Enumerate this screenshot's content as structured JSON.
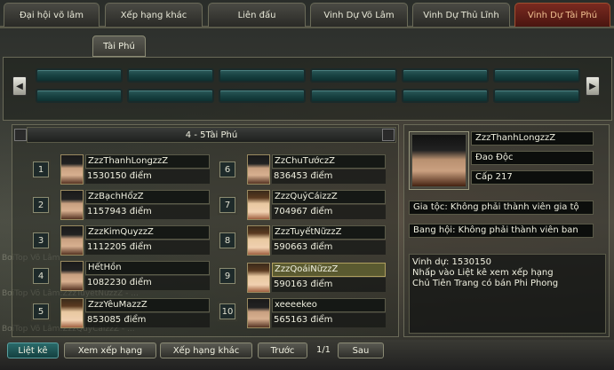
{
  "top_tabs": [
    {
      "label": "Đại hội võ lâm",
      "active": false
    },
    {
      "label": "Xếp hạng khác",
      "active": false
    },
    {
      "label": "Liên đấu",
      "active": false
    },
    {
      "label": "Vinh Dự Võ Lâm",
      "active": false
    },
    {
      "label": "Vinh Dự Thủ Lĩnh",
      "active": false
    },
    {
      "label": "Vinh Dự Tài Phú",
      "active": true
    }
  ],
  "sub_tab": {
    "label": "Tài Phú"
  },
  "ranking": {
    "header": "4 - 5Tài Phú",
    "entries": [
      {
        "rank": "1",
        "name": "ZzzThanhLongzzZ",
        "score": "1530150 điểm",
        "gender": "m"
      },
      {
        "rank": "2",
        "name": "ZzBạchHổzZ",
        "score": "1157943 điểm",
        "gender": "m"
      },
      {
        "rank": "3",
        "name": "ZzzKimQuyzzZ",
        "score": "1112205 điểm",
        "gender": "m"
      },
      {
        "rank": "4",
        "name": "HếtHồn",
        "score": "1082230 điểm",
        "gender": "m"
      },
      {
        "rank": "5",
        "name": "ZzzYêuMazzZ",
        "score": "853085 điểm",
        "gender": "f"
      },
      {
        "rank": "6",
        "name": "ZzChuTướczZ",
        "score": "836453 điểm",
        "gender": "m"
      },
      {
        "rank": "7",
        "name": "ZzzQuỷCáizzZ",
        "score": "704967 điểm",
        "gender": "f"
      },
      {
        "rank": "8",
        "name": "ZzzTuyếtNữzzZ",
        "score": "590663 điểm",
        "gender": "f"
      },
      {
        "rank": "9",
        "name": "ZzzQoáiNữzzZ",
        "score": "590163 điểm",
        "gender": "f",
        "highlight": true
      },
      {
        "rank": "10",
        "name": "xeeeekeo",
        "score": "565163 điểm",
        "gender": "m"
      }
    ]
  },
  "detail": {
    "name": "ZzzThanhLongzzZ",
    "school": "Đao Độc",
    "level": "Cấp 217",
    "family": "Gia tộc: Không phải thành viên gia tộ",
    "guild": "Bang hội: Không phải thành viên ban",
    "info_lines": [
      "Vinh dự: 1530150",
      " Nhấp vào Liệt kê xem  xếp hạng",
      " Chủ Tiên Trang có bán Phi Phong"
    ]
  },
  "background_text": [
    "BơiTop Võ Lâm",
    "BơiTop Võ Lâm:ZzzTuyếtNữzzZ - ...",
    "BơiTop Võ Lâm:ZzzQuỷCáizzZ - ..."
  ],
  "bottom": {
    "list_label": "Liệt kê",
    "view_rank_label": "Xem xếp hạng",
    "other_rank_label": "Xếp hạng khác",
    "prev_label": "Trước",
    "page": "1/1",
    "next_label": "Sau"
  },
  "icons": {
    "left_arrow": "◀",
    "right_arrow": "▶"
  }
}
